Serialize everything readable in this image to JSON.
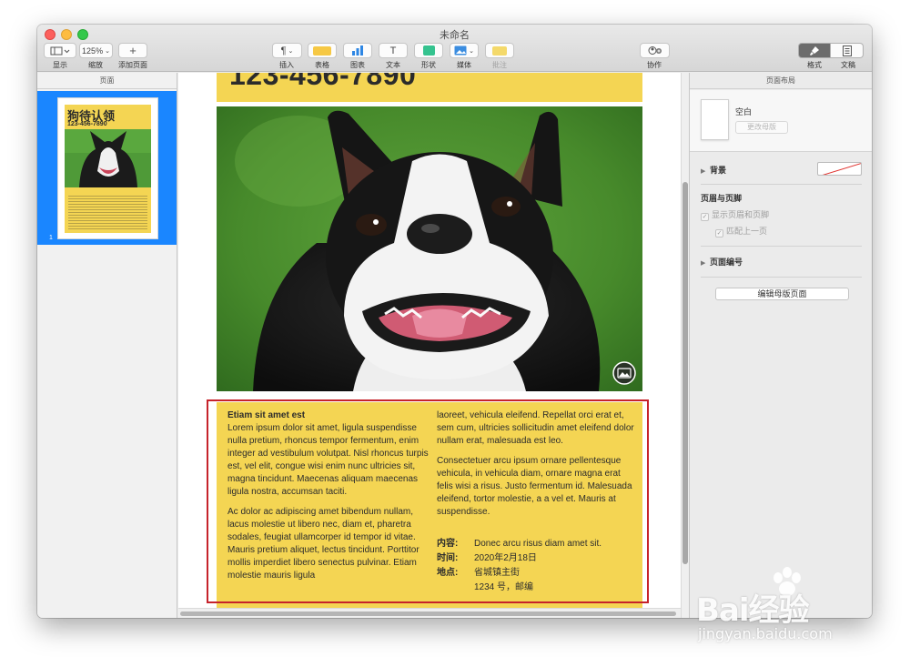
{
  "window": {
    "title": "未命名"
  },
  "toolbar": {
    "view_label": "显示",
    "zoom_value": "125%",
    "zoom_label": "缩放",
    "add_page_label": "添加页面",
    "insert_label": "插入",
    "table_label": "表格",
    "chart_label": "图表",
    "text_label": "文本",
    "shape_label": "形状",
    "media_label": "媒体",
    "comment_label": "批注",
    "collab_label": "协作",
    "format_label": "格式",
    "document_label": "文稿",
    "colors": {
      "table": "#f6c844",
      "chart": "#2d86e4",
      "shape": "#35c38f",
      "media": "#3b8de0",
      "comment": "#f4d96a"
    }
  },
  "pages_panel": {
    "title": "页面",
    "thumbnail": {
      "page_number": "1",
      "title": "狗待认领",
      "phone": "123-456-7890"
    }
  },
  "document": {
    "phone": "123-456-7890",
    "body": {
      "heading": "Etiam sit amet est",
      "col1_p1": "Lorem ipsum dolor sit amet, ligula suspendisse nulla pretium, rhoncus tempor fermentum, enim integer ad vestibulum volutpat. Nisl rhoncus turpis est, vel elit, congue wisi enim nunc ultricies sit, magna tincidunt. Maecenas aliquam maecenas ligula nostra, accumsan taciti.",
      "col1_p2": "Ac dolor ac adipiscing amet bibendum nullam, lacus molestie ut libero nec, diam et, pharetra sodales, feugiat ullamcorper id tempor id vitae. Mauris pretium aliquet, lectus tincidunt. Porttitor mollis imperdiet libero senectus pulvinar. Etiam molestie mauris ligula",
      "col2_p1": "laoreet, vehicula eleifend. Repellat orci erat et, sem cum, ultricies sollicitudin amet eleifend dolor nullam erat, malesuada est leo.",
      "col2_p2": "Consectetuer arcu ipsum ornare pellentesque vehicula, in vehicula diam, ornare magna erat felis wisi a risus. Justo fermentum id. Malesuada eleifend, tortor molestie, a a vel et. Mauris at suspendisse."
    },
    "info": {
      "content_label": "内容:",
      "content_value": "Donec arcu risus diam amet sit.",
      "time_label": "时间:",
      "time_value": "2020年2月18日",
      "place_label": "地点:",
      "place_value_1": "省城镇主街",
      "place_value_2": "1234 号，邮编"
    },
    "yellow": "#f4d553"
  },
  "inspector": {
    "title": "页面布局",
    "master_name": "空白",
    "change_master_button": "更改母版",
    "background_label": "背景",
    "header_footer_title": "页眉与页脚",
    "show_header_footer": "显示页眉和页脚",
    "match_previous": "匹配上一页",
    "page_numbers_label": "页面编号",
    "edit_master_button": "编辑母版页面"
  },
  "watermark": {
    "brand": "Bai经验",
    "url": "jingyan.baidu.com"
  }
}
